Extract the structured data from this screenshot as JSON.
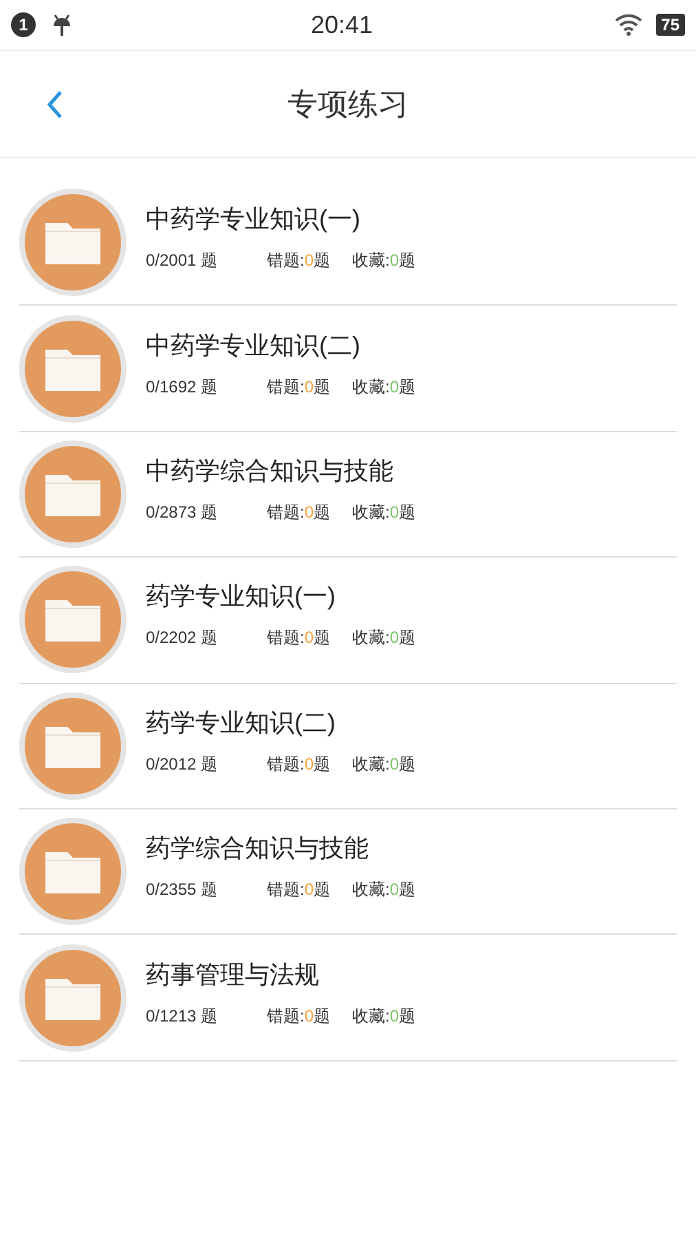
{
  "status_bar": {
    "notification_count": "1",
    "time": "20:41",
    "battery": "75"
  },
  "header": {
    "title": "专项练习"
  },
  "items": [
    {
      "title": "中药学专业知识(一)",
      "progress": "0/2001 题",
      "wrong_label": "错题:",
      "wrong_count": "0",
      "wrong_unit": "题",
      "fav_label": "收藏:",
      "fav_count": "0",
      "fav_unit": "题"
    },
    {
      "title": "中药学专业知识(二)",
      "progress": "0/1692 题",
      "wrong_label": "错题:",
      "wrong_count": "0",
      "wrong_unit": "题",
      "fav_label": "收藏:",
      "fav_count": "0",
      "fav_unit": "题"
    },
    {
      "title": "中药学综合知识与技能",
      "progress": "0/2873 题",
      "wrong_label": "错题:",
      "wrong_count": "0",
      "wrong_unit": "题",
      "fav_label": "收藏:",
      "fav_count": "0",
      "fav_unit": "题"
    },
    {
      "title": "药学专业知识(一)",
      "progress": "0/2202 题",
      "wrong_label": "错题:",
      "wrong_count": "0",
      "wrong_unit": "题",
      "fav_label": "收藏:",
      "fav_count": "0",
      "fav_unit": "题"
    },
    {
      "title": "药学专业知识(二)",
      "progress": "0/2012 题",
      "wrong_label": "错题:",
      "wrong_count": "0",
      "wrong_unit": "题",
      "fav_label": "收藏:",
      "fav_count": "0",
      "fav_unit": "题"
    },
    {
      "title": "药学综合知识与技能",
      "progress": "0/2355 题",
      "wrong_label": "错题:",
      "wrong_count": "0",
      "wrong_unit": "题",
      "fav_label": "收藏:",
      "fav_count": "0",
      "fav_unit": "题"
    },
    {
      "title": "药事管理与法规",
      "progress": "0/1213 题",
      "wrong_label": "错题:",
      "wrong_count": "0",
      "wrong_unit": "题",
      "fav_label": "收藏:",
      "fav_count": "0",
      "fav_unit": "题"
    }
  ]
}
